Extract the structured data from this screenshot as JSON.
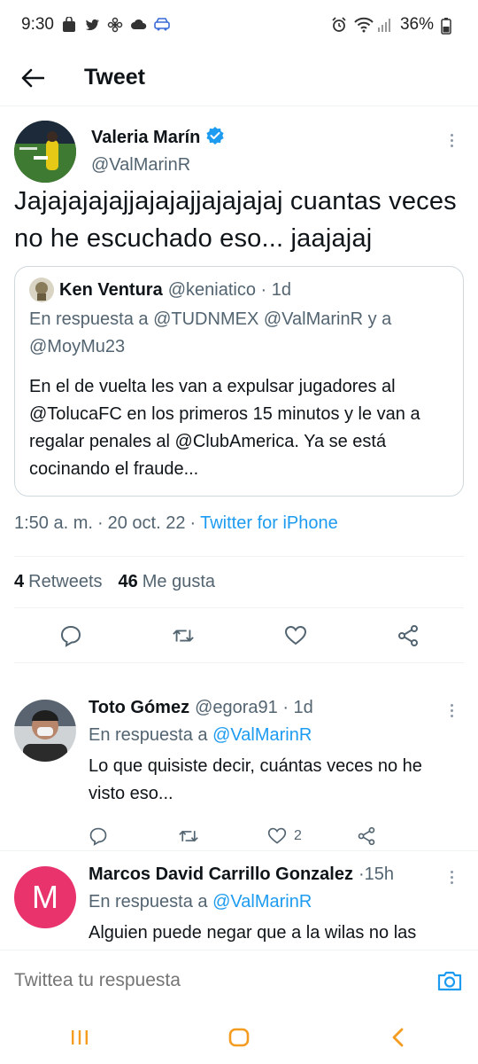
{
  "status_bar": {
    "time": "9:30",
    "battery": "36%"
  },
  "header": {
    "title": "Tweet"
  },
  "tweet": {
    "author_name": "Valeria Marín",
    "author_handle": "@ValMarinR",
    "text": "Jajajajajajjajajajjajajajaj cuantas veces no he escuchado eso... jaajajaj",
    "quote": {
      "author_name": "Ken Ventura",
      "author_handle": "@keniatico · 1d",
      "reply_prefix": "En respuesta a",
      "reply_mentions": "@TUDNMEX @ValMarinR",
      "reply_and": "y a",
      "reply_mention_last": "@MoyMu23",
      "text": "En el de vuelta les van a expulsar jugadores al @TolucaFC  en los primeros 15 minutos y le van a regalar penales al @ClubAmerica. Ya se está cocinando el fraude..."
    },
    "time": "1:50 a. m.",
    "sep1": "·",
    "date": "20 oct. 22",
    "sep2": "·",
    "source": "Twitter for iPhone",
    "retweets_count": "4",
    "retweets_label": "Retweets",
    "likes_count": "46",
    "likes_label": "Me gusta"
  },
  "replies": [
    {
      "author_name": "Toto Gómez",
      "author_handle": "@egora91 · 1d",
      "reply_prefix": "En respuesta a",
      "reply_to": "@ValMarinR",
      "text": "Lo que quisiste decir, cuántas veces no he visto eso...",
      "likes": "2"
    },
    {
      "author_name": "Marcos David Carrillo Gonzalez",
      "author_handle": "·15h",
      "avatar_letter": "M",
      "reply_prefix": "En respuesta a",
      "reply_to": "@ValMarinR",
      "text": "Alguien puede negar que a la wilas no las"
    }
  ],
  "compose": {
    "placeholder": "Twittea tu respuesta"
  },
  "colors": {
    "accent": "#1d9bf0",
    "muted": "#536471",
    "avatar_m": "#e8336d",
    "nav_orange": "#f39c1f"
  }
}
